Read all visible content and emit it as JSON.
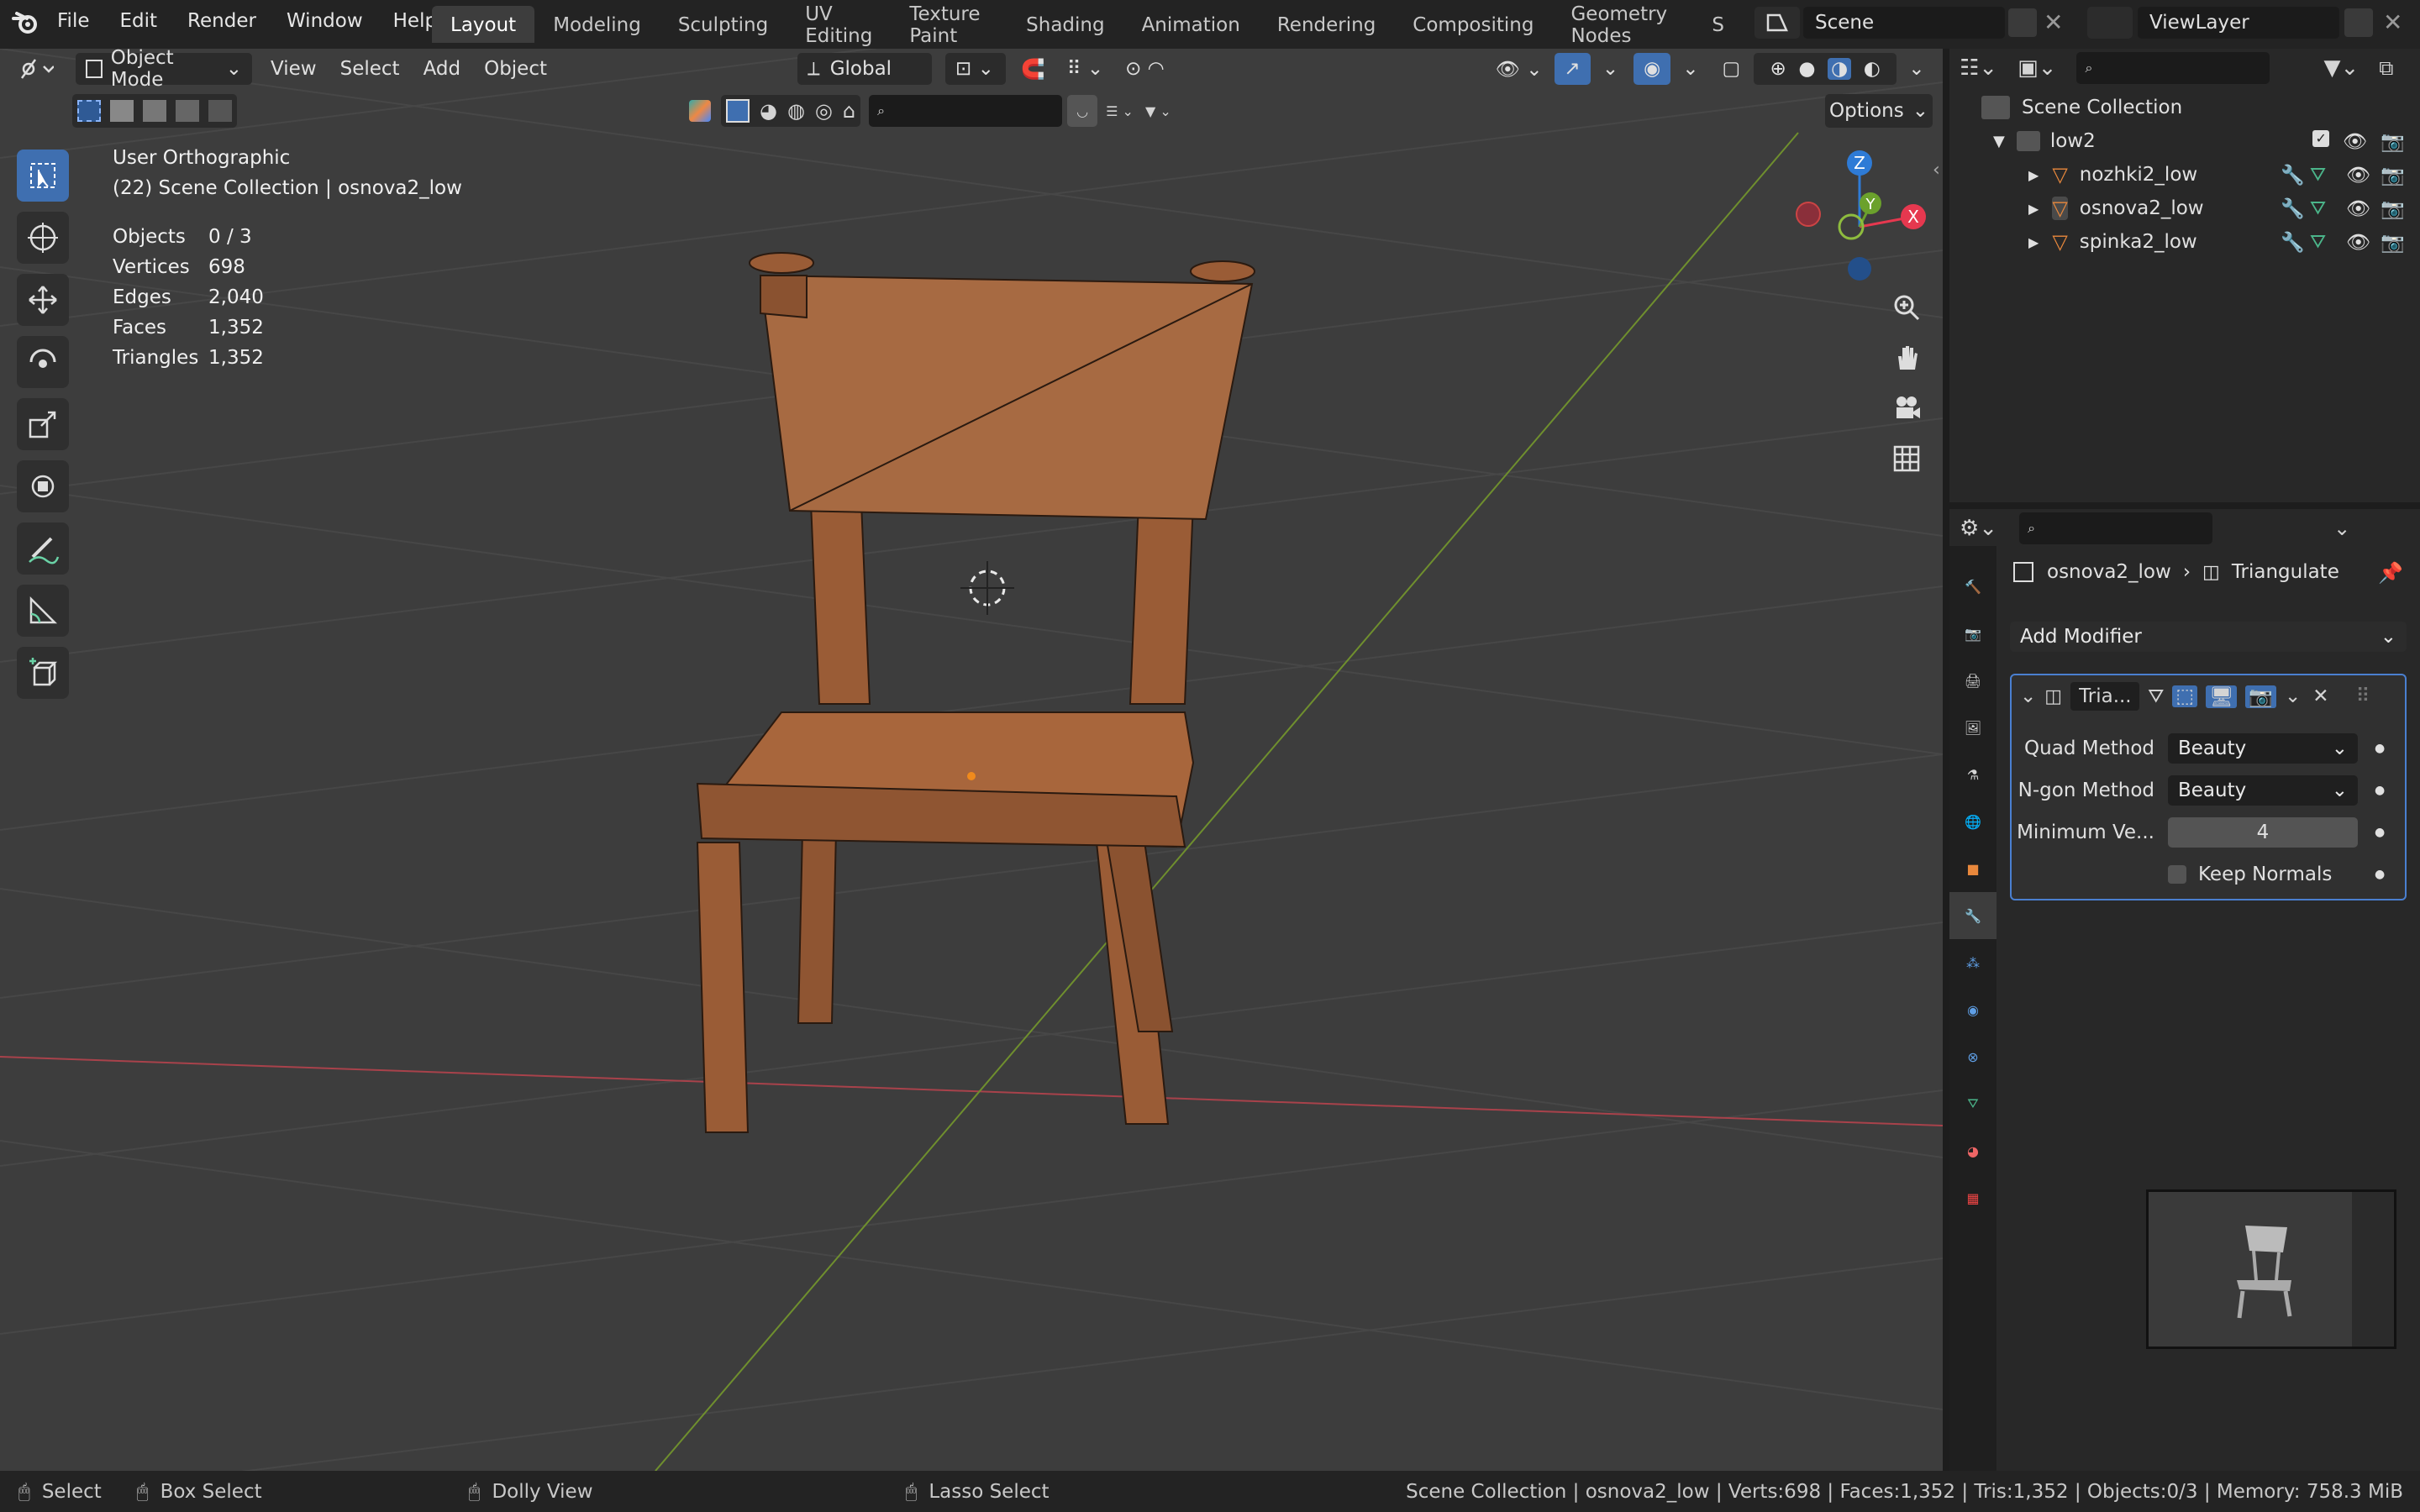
{
  "app": {
    "logo": "blender-logo-icon"
  },
  "menu": [
    "File",
    "Edit",
    "Render",
    "Window",
    "Help"
  ],
  "workspaces": [
    "Layout",
    "Modeling",
    "Sculpting",
    "UV Editing",
    "Texture Paint",
    "Shading",
    "Animation",
    "Rendering",
    "Compositing",
    "Geometry Nodes",
    "S"
  ],
  "active_workspace": "Layout",
  "scene": {
    "name": "Scene",
    "view_layer": "ViewLayer"
  },
  "viewport_header": {
    "mode": "Object Mode",
    "menus": [
      "View",
      "Select",
      "Add",
      "Object"
    ],
    "transform_orientation": "Global",
    "options_label": "Options"
  },
  "overlay_text": {
    "view_name": "User Orthographic",
    "collection_line": "(22) Scene Collection | osnova2_low",
    "stats": [
      {
        "label": "Objects",
        "value": "0 / 3"
      },
      {
        "label": "Vertices",
        "value": "698"
      },
      {
        "label": "Edges",
        "value": "2,040"
      },
      {
        "label": "Faces",
        "value": "1,352"
      },
      {
        "label": "Triangles",
        "value": "1,352"
      }
    ]
  },
  "gizmo": {
    "x": "X",
    "y": "Y",
    "z": "Z",
    "x_color": "#e6384f",
    "y_color": "#6ba12c",
    "z_color": "#2e7bd6"
  },
  "outliner": {
    "root": "Scene Collection",
    "collection": "low2",
    "objects": [
      {
        "name": "nozhki2_low"
      },
      {
        "name": "osnova2_low"
      },
      {
        "name": "spinka2_low"
      }
    ]
  },
  "properties": {
    "breadcrumb_object": "osnova2_low",
    "breadcrumb_modifier": "Triangulate",
    "add_modifier_label": "Add Modifier",
    "modifier_name": "Tria...",
    "fields": [
      {
        "label": "Quad Method",
        "value": "Beauty"
      },
      {
        "label": "N-gon Method",
        "value": "Beauty"
      }
    ],
    "min_vertices_label": "Minimum Ve...",
    "min_vertices_value": "4",
    "keep_normals_label": "Keep Normals"
  },
  "status_bar": {
    "select": "Select",
    "box_select": "Box Select",
    "dolly": "Dolly View",
    "lasso": "Lasso Select",
    "info": "Scene Collection | osnova2_low | Verts:698 | Faces:1,352 | Tris:1,352 | Objects:0/3 | Memory: 758.3 MiB"
  },
  "colors": {
    "accent": "#3f6fb0",
    "wood": "#a0603a",
    "active_tool": "#3f6fb0",
    "object_icon": "#e9883c",
    "mesh_icon": "#4bb58a"
  }
}
